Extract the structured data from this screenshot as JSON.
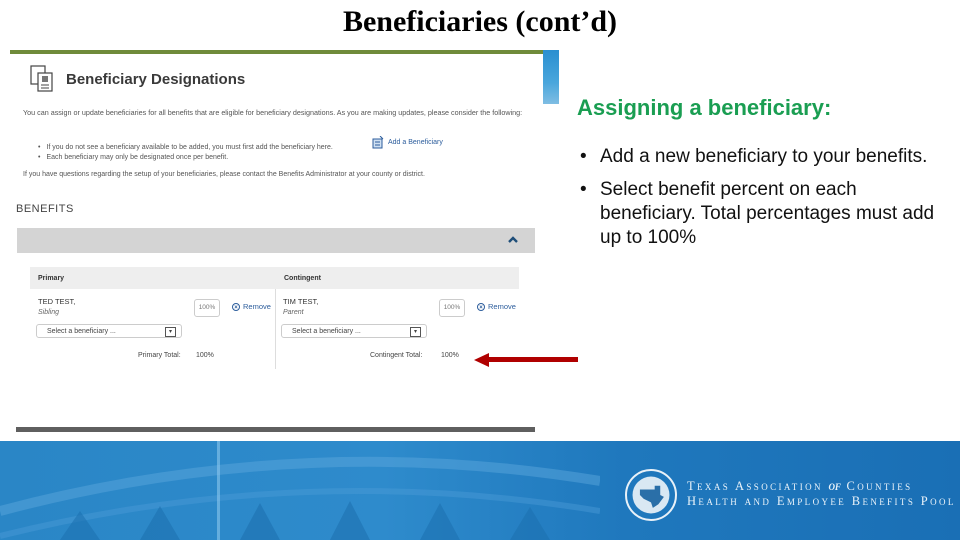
{
  "slide": {
    "title": "Beneficiaries (cont’d)",
    "heading": "Assigning a beneficiary:",
    "bullets": [
      "Add a new beneficiary to your benefits.",
      "Select benefit percent on each beneficiary. Total percentages must add up to 100%"
    ],
    "colors": {
      "heading": "#1a9e52",
      "rule": "#6f8b3a",
      "footer": "#2a86c6",
      "arrow": "#b00000"
    }
  },
  "screenshot": {
    "section_title": "Beneficiary Designations",
    "intro": "You can assign or update beneficiaries for all benefits that are eligible for beneficiary designations. As you are making updates, please consider the following:",
    "notes": [
      "If you do not see a beneficiary available to be added, you must first add the beneficiary here.",
      "Each beneficiary may only be designated once per benefit."
    ],
    "add_beneficiary_link": "Add a Beneficiary",
    "contact_text": "If you have questions regarding the setup of your beneficiaries, please contact the Benefits Administrator at your county or district.",
    "benefits_label": "BENEFITS",
    "primary": {
      "header": "Primary",
      "name": "TED TEST,",
      "relationship": "Sibling",
      "percent": "100%",
      "remove_label": "Remove",
      "select_placeholder": "Select a beneficiary ...",
      "total_label": "Primary Total:",
      "total_value": "100%"
    },
    "contingent": {
      "header": "Contingent",
      "name": "TIM TEST,",
      "relationship": "Parent",
      "percent": "100%",
      "remove_label": "Remove",
      "select_placeholder": "Select a beneficiary ...",
      "total_label": "Contingent Total:",
      "total_value": "100%"
    }
  },
  "footer": {
    "org_line1_a": "Texas Association ",
    "org_line1_of": "of",
    "org_line1_b": " Counties",
    "org_line2": "Health and Employee Benefits Pool"
  }
}
